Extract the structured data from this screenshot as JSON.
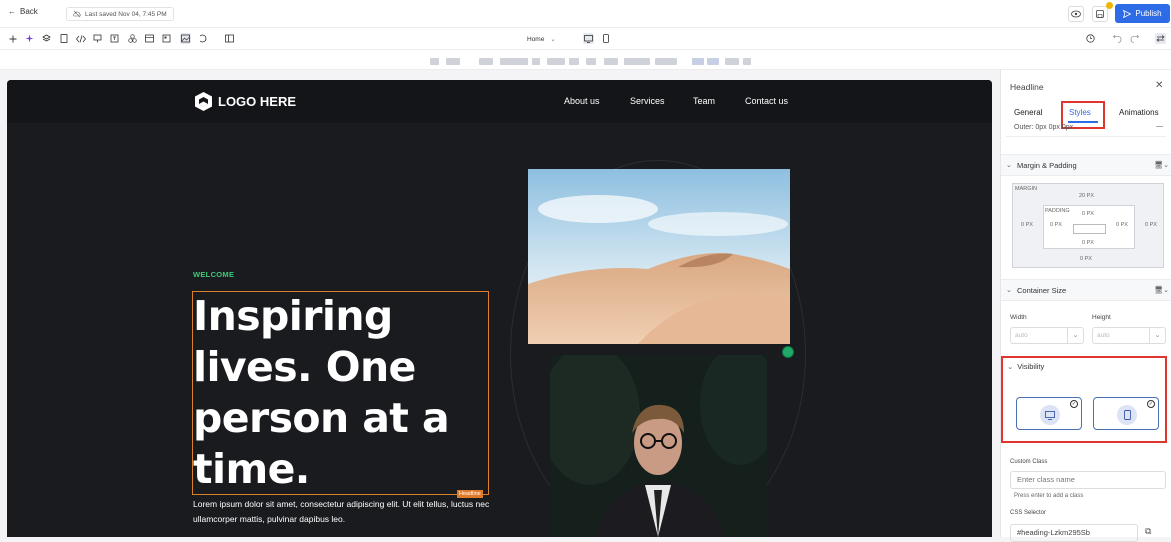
{
  "topbar": {
    "back_label": "Back",
    "saved_label": "Last saved Nov 04, 7:45 PM",
    "publish_label": "Publish",
    "preview_icon": "eye-icon",
    "save_icon": "save-icon"
  },
  "toolbar": {
    "page_select": "Home",
    "icons": [
      "plus-icon",
      "sparkle-icon",
      "layers-icon",
      "pages-icon",
      "code-icon",
      "component-icon",
      "form-icon",
      "table-icon",
      "widgets-icon",
      "section-icon",
      "template-icon",
      "image-icon",
      "media-icon",
      "sidebar-toggle-icon"
    ],
    "right_icons": [
      "history-icon",
      "undo-icon",
      "redo-icon",
      "settings-icon"
    ]
  },
  "canvas": {
    "logo_text": "LOGO HERE",
    "nav_links": [
      "About us",
      "Services",
      "Team",
      "Contact us"
    ],
    "welcome": "WELCOME",
    "headline": "Inspiring lives. One person at a time.",
    "headline_tag": "Headline",
    "body_text": "Lorem ipsum dolor sit amet, consectetur adipiscing elit. Ut elit tellus, luctus nec ullamcorper mattis, pulvinar dapibus leo."
  },
  "panel": {
    "title": "Headline",
    "tabs": [
      "General",
      "Styles",
      "Animations"
    ],
    "active_tab": "Styles",
    "outer_value": "Outer: 0px 0px 0px",
    "margin_padding": {
      "label": "Margin & Padding",
      "margin_label": "MARGIN",
      "padding_label": "PADDING",
      "margin_top": "20 PX",
      "margin_left": "0 PX",
      "margin_right": "0 PX",
      "margin_bottom": "0 PX",
      "padding_top": "0 PX",
      "padding_left": "0 PX",
      "padding_right": "0 PX",
      "padding_bottom": "0 PX"
    },
    "container_size": {
      "label": "Container Size",
      "width_label": "Width",
      "height_label": "Height",
      "width_value": "auto",
      "height_value": "auto"
    },
    "visibility": {
      "label": "Visibility",
      "desktop_checked": true,
      "mobile_checked": true
    },
    "custom_class": {
      "label": "Custom Class",
      "placeholder": "Enter class name",
      "hint": "Press enter to add a class"
    },
    "css_selector": {
      "label": "CSS Selector",
      "value": "#heading-Lzkm295Sb"
    }
  },
  "colors": {
    "accent": "#2e6be6",
    "highlight": "#e0342e",
    "welcome": "#3ec97a",
    "canvas_bg": "#1a1b1e"
  }
}
